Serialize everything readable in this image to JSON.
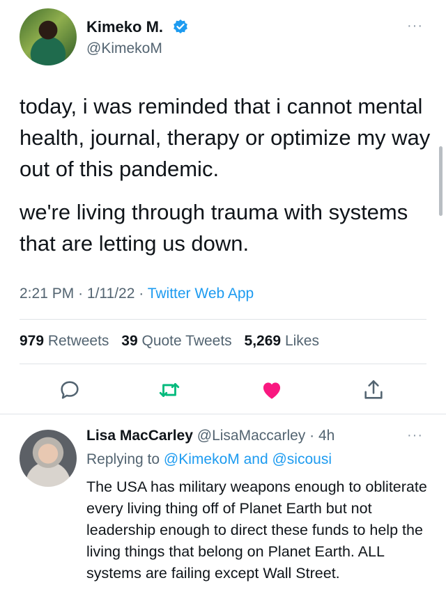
{
  "tweet": {
    "author_name": "Kimeko M.",
    "author_handle": "@KimekoM",
    "paragraph_1": "today, i was reminded that i cannot mental health, journal, therapy or optimize my way out of this pandemic.",
    "paragraph_2": "we're living through trauma with systems that are letting us down.",
    "time": "2:21 PM",
    "date": "1/11/22",
    "source": "Twitter Web App",
    "retweets_count": "979",
    "retweets_label": "Retweets",
    "quote_count": "39",
    "quote_label": "Quote Tweets",
    "likes_count": "5,269",
    "likes_label": "Likes",
    "more_glyph": "···"
  },
  "reply": {
    "author_name": "Lisa MacCarley",
    "author_handle": "@LisaMaccarley",
    "age": "4h",
    "replying_prefix": "Replying to",
    "replying_to_1": "@KimekoM",
    "replying_and": "and",
    "replying_to_2": "@sicousi",
    "text": "The USA has military weapons enough to obliterate every living thing off of Planet Earth but not leadership enough to direct these funds to help the living things that belong on Planet Earth. ALL systems are failing except Wall Street.",
    "more_glyph": "···"
  },
  "colors": {
    "accent": "#1d9bf0",
    "retweet": "#00ba7c",
    "like": "#f91880",
    "muted": "#536471"
  },
  "icons": [
    "verified-badge-icon",
    "reply-icon",
    "retweet-icon",
    "like-heart-icon",
    "share-icon",
    "more-icon"
  ]
}
